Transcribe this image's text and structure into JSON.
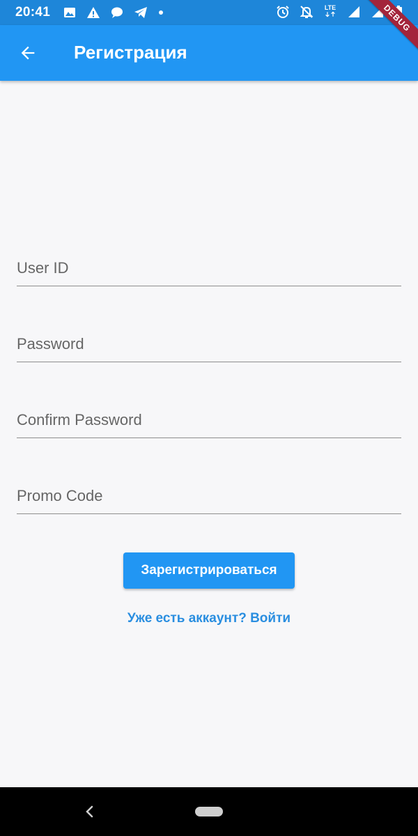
{
  "status_bar": {
    "time": "20:41",
    "network_label": "LTE",
    "left_icons": [
      "image-icon",
      "warning-icon",
      "chat-bubble-icon",
      "telegram-icon",
      "dot-icon"
    ],
    "right_icons": [
      "alarm-icon",
      "notifications-off-icon",
      "lte-icon",
      "signal-icon",
      "signal-icon",
      "battery-icon"
    ]
  },
  "debug_banner": "DEBUG",
  "app_bar": {
    "back_icon": "arrow-back-icon",
    "title": "Регистрация",
    "color": "#2196f3"
  },
  "form": {
    "user_id": {
      "placeholder": "User ID",
      "value": ""
    },
    "password": {
      "placeholder": "Password",
      "value": ""
    },
    "confirm_password": {
      "placeholder": "Confirm Password",
      "value": ""
    },
    "promo_code": {
      "placeholder": "Promo Code",
      "value": ""
    },
    "register_label": "Зарегистрироваться",
    "login_link": "Уже есть аккаунт? Войти"
  },
  "nav_bar": {
    "back_icon": "nav-back-icon",
    "home_icon": "home-pill-icon"
  }
}
